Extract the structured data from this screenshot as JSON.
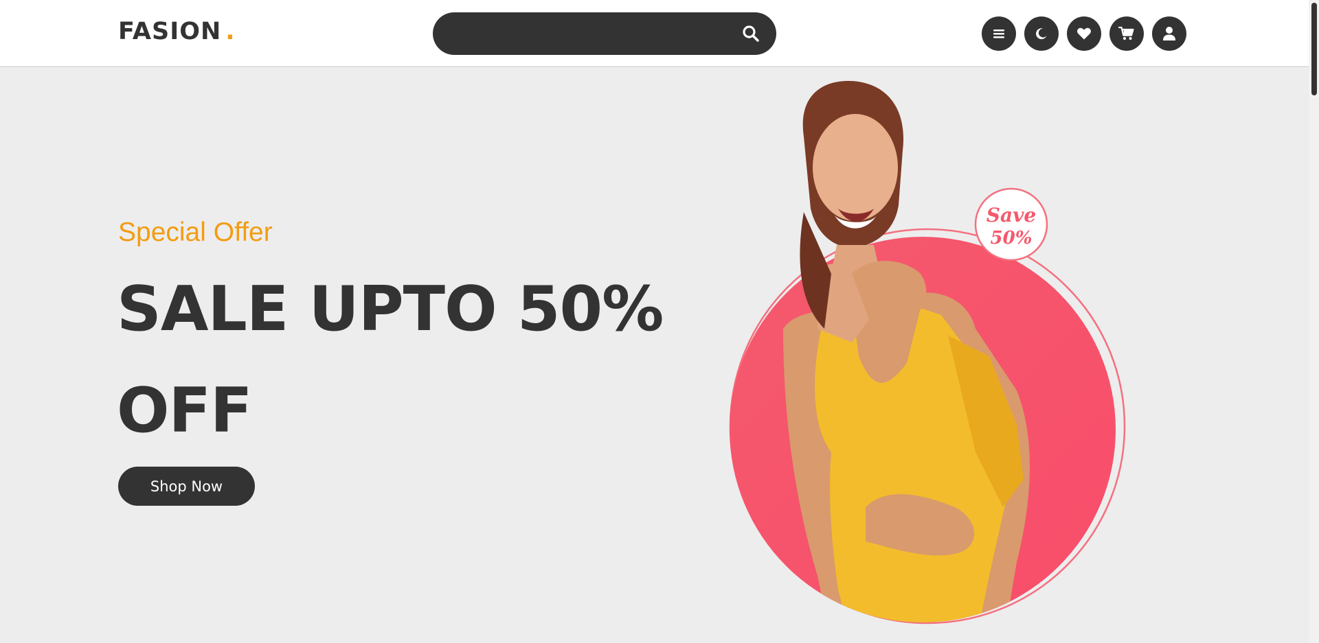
{
  "header": {
    "logo_text": "FASION",
    "logo_dot": ".",
    "search": {
      "placeholder": ""
    },
    "icons": [
      "menu-icon",
      "moon-icon",
      "heart-icon",
      "cart-icon",
      "user-icon"
    ]
  },
  "hero": {
    "subtitle": "Special Offer",
    "title": "SALE UPTO 50% OFF",
    "button_label": "Shop Now",
    "badge_line1": "Save",
    "badge_line2": "50%"
  },
  "colors": {
    "accent": "#f39c12",
    "dark": "#333333",
    "hero_bg": "#ededed",
    "circle": "#f7566c",
    "dress": "#f3bc2c"
  }
}
